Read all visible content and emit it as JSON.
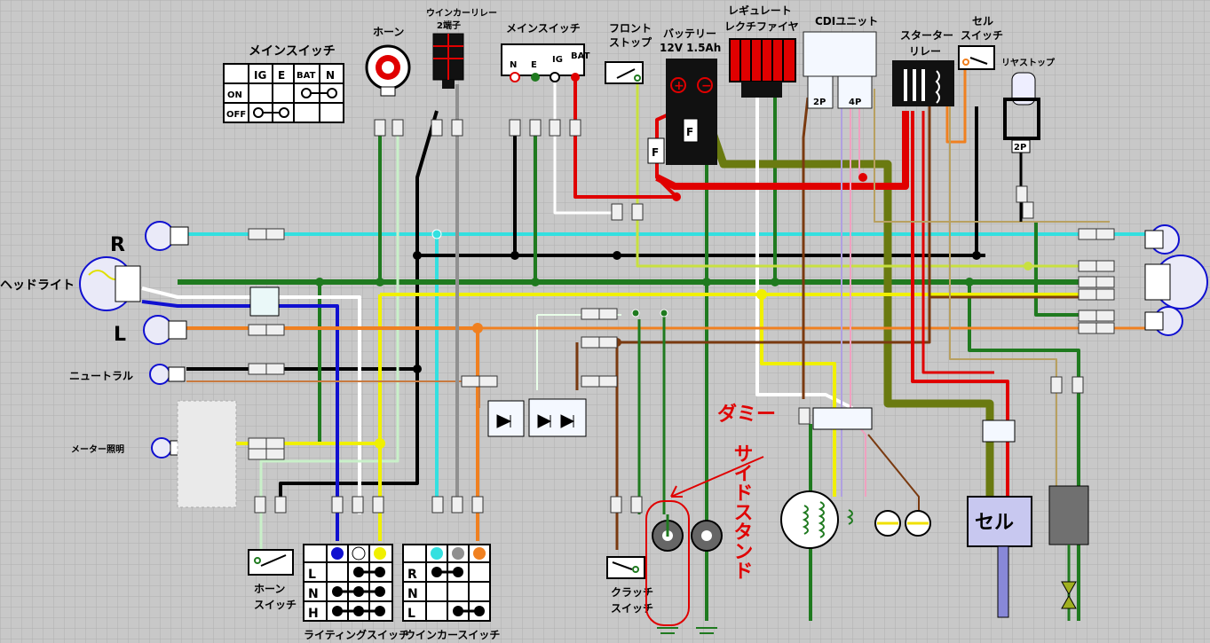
{
  "labels": {
    "main_switch_table_title": "メインスイッチ",
    "main_switch_ig": "IG",
    "main_switch_e": "E",
    "main_switch_bat": "BAT",
    "main_switch_n": "N",
    "main_switch_on": "ON",
    "main_switch_off": "OFF",
    "horn": "ホーン",
    "winker_relay_1": "ウインカーリレー",
    "winker_relay_2": "2端子",
    "main_switch_conn": "メインスイッチ",
    "conn_n": "N",
    "conn_e": "E",
    "conn_ig": "IG",
    "conn_bat": "BAT",
    "front_stop_1": "フロント",
    "front_stop_2": "ストップ",
    "battery_1": "バッテリー",
    "battery_2": "12V 1.5Ah",
    "regulator_1": "レギュレート",
    "regulator_2": "レクチファイヤ",
    "cdi_unit": "CDIユニット",
    "cdi_2p": "2P",
    "cdi_4p": "4P",
    "starter_relay_1": "スターター",
    "starter_relay_2": "リレー",
    "cell_switch_1": "セル",
    "cell_switch_2": "スイッチ",
    "rear_stop": "リヤストップ",
    "rear_2p": "2P",
    "fuse_f": "F",
    "right_r": "R",
    "headlight": "ヘッドライト",
    "left_l": "L",
    "neutral": "ニュートラル",
    "meter_light": "メーター照明",
    "horn_switch_1": "ホーン",
    "horn_switch_2": "スイッチ",
    "lighting_switch": "ライティングスイッチ",
    "lighting_l": "L",
    "lighting_n": "N",
    "lighting_h": "H",
    "winker_switch": "ウインカースイッチ",
    "winker_r": "R",
    "winker_n": "N",
    "winker_l": "L",
    "clutch_switch_1": "クラッチ",
    "clutch_switch_2": "スイッチ",
    "starter_motor": "セル",
    "dummy_note_1": "ダミー",
    "dummy_note_2": "サイドスタンド"
  },
  "colors": {
    "green": "#1f7a1f",
    "light_green": "#c9f0c9",
    "black": "#000000",
    "red": "#e00000",
    "white": "#ffffff",
    "yellow": "#f0f000",
    "cyan": "#33e0e0",
    "orange": "#f08020",
    "blue": "#1010d0",
    "brown": "#7a3a10",
    "grey": "#909090",
    "pink": "#f0a0c0",
    "olive": "#6a7a10",
    "yellow_green": "#c8e040"
  }
}
